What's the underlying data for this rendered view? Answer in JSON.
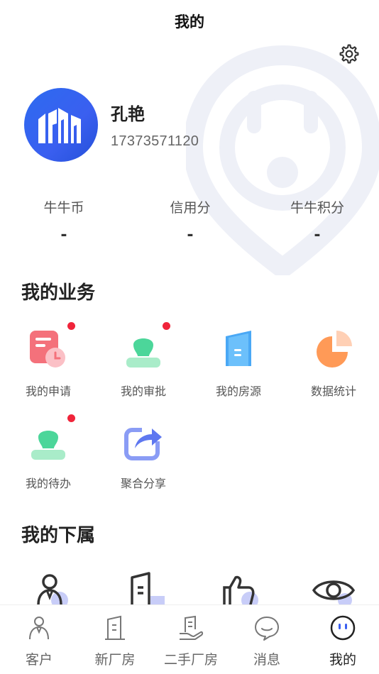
{
  "header": {
    "title": "我的"
  },
  "profile": {
    "name": "孔艳",
    "phone": "17373571120"
  },
  "stats": [
    {
      "label": "牛牛币",
      "value": "-"
    },
    {
      "label": "信用分",
      "value": "-"
    },
    {
      "label": "牛牛积分",
      "value": "-"
    }
  ],
  "business": {
    "title": "我的业务",
    "items": [
      {
        "label": "我的申请",
        "icon": "application-icon",
        "badge": true
      },
      {
        "label": "我的审批",
        "icon": "approval-icon",
        "badge": true
      },
      {
        "label": "我的房源",
        "icon": "listing-icon",
        "badge": false
      },
      {
        "label": "数据统计",
        "icon": "pie-chart-icon",
        "badge": false
      },
      {
        "label": "我的待办",
        "icon": "todo-icon",
        "badge": true
      },
      {
        "label": "聚合分享",
        "icon": "share-icon",
        "badge": false
      }
    ]
  },
  "subordinates": {
    "title": "我的下属",
    "icons": [
      "person-icon",
      "building-icon",
      "thumbs-up-icon",
      "eye-icon"
    ]
  },
  "tabbar": {
    "items": [
      {
        "label": "客户",
        "icon": "customer-icon",
        "active": false
      },
      {
        "label": "新厂房",
        "icon": "new-factory-icon",
        "active": false
      },
      {
        "label": "二手厂房",
        "icon": "used-factory-icon",
        "active": false
      },
      {
        "label": "消息",
        "icon": "message-icon",
        "active": false
      },
      {
        "label": "我的",
        "icon": "mine-icon",
        "active": true
      }
    ]
  },
  "colors": {
    "accent": "#2d6bf0",
    "badge": "#f0243a",
    "text": "#222222",
    "muted": "#666666"
  }
}
